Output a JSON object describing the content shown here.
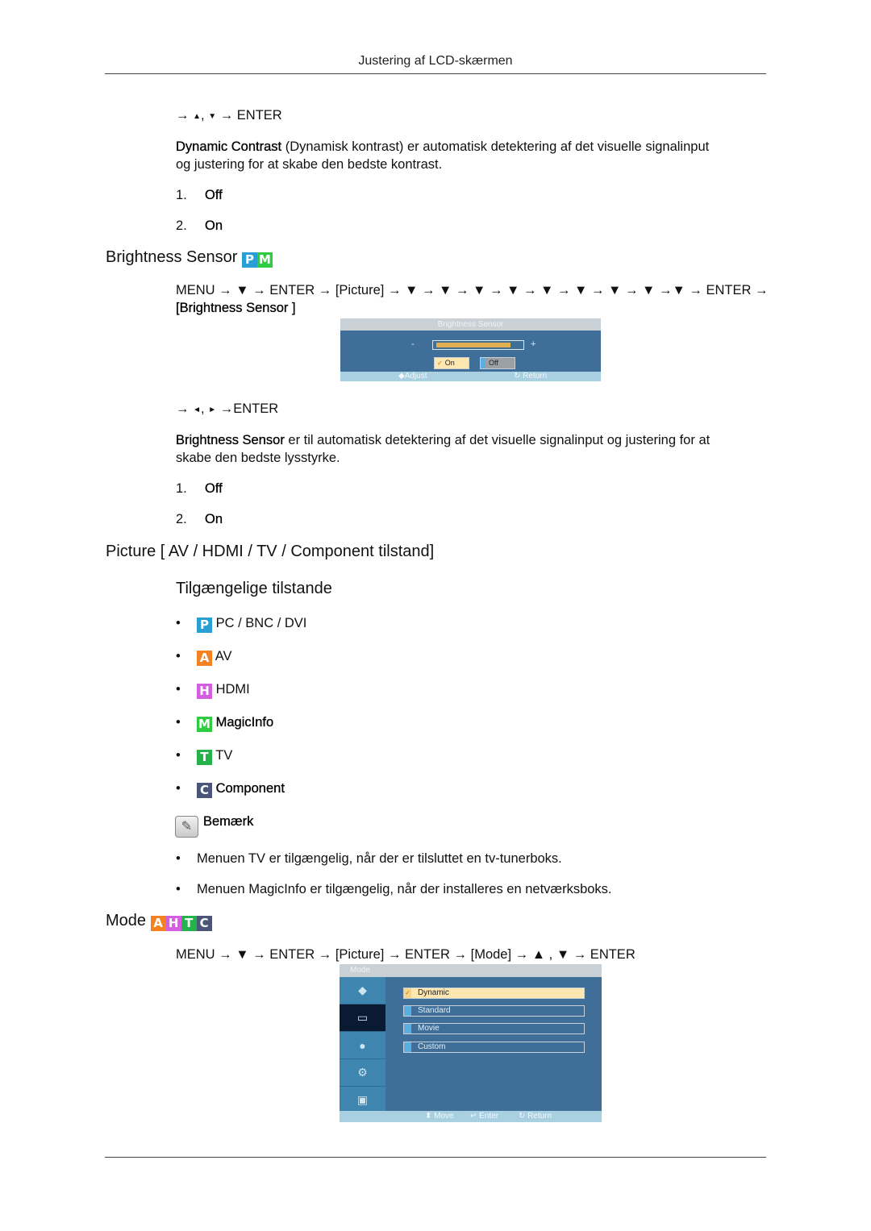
{
  "header": {
    "title": "Justering af LCD-skærmen"
  },
  "dynamic_contrast": {
    "nav": {
      "prefix": "→",
      "up": "▲",
      "sep": ",",
      "down": "▼",
      "suffix": "→ ENTER"
    },
    "term": "Dynamic Contrast",
    "description_line1": " (Dynamisk kontrast) er automatisk detektering af det visuelle signalinput",
    "description_line2": "og justering for at skabe den bedste kontrast.",
    "options": [
      {
        "num": "1.",
        "label": "Off"
      },
      {
        "num": "2.",
        "label": "On"
      }
    ]
  },
  "brightness_sensor": {
    "heading": "Brightness Sensor",
    "badges": [
      {
        "letter": "P",
        "color": "#2a9fd6"
      },
      {
        "letter": "M",
        "color": "#2ecc40"
      }
    ],
    "menu_path_line1": "MENU → ▼ → ENTER → [Picture] → ▼ → ▼ → ▼ → ▼ → ▼ → ▼ → ▼ → ▼ →▼ → ENTER →",
    "menu_path_line2": "[Brightness Sensor ]",
    "osd": {
      "title": "Brightness Sensor",
      "minus": "-",
      "plus": "+",
      "level_percent": 88,
      "on_label": "On",
      "off_label": "Off",
      "check": "✓",
      "footer_adjust": "◆Adjust",
      "footer_return": "↻ Return"
    },
    "nav": {
      "prefix": "→",
      "left": "◄",
      "sep": ",",
      "right": "►",
      "suffix": "→ENTER"
    },
    "term": "Brightness Sensor",
    "description_line1": "  er til automatisk detektering af det visuelle signalinput og justering for at",
    "description_line2": "skabe den bedste lysstyrke.",
    "options": [
      {
        "num": "1.",
        "label": "Off"
      },
      {
        "num": "2.",
        "label": "On"
      }
    ]
  },
  "picture_section": {
    "heading": "Picture [ AV / HDMI / TV / Component tilstand]",
    "subheading": "Tilgængelige tilstande",
    "modes": [
      {
        "letter": "P",
        "color": "#2a9fd6",
        "label": "PC / BNC / DVI"
      },
      {
        "letter": "A",
        "color": "#f58220",
        "label": "AV"
      },
      {
        "letter": "H",
        "color": "#d35fe0",
        "label": "HDMI"
      },
      {
        "letter": "M",
        "color": "#2ecc40",
        "label": "MagicInfo"
      },
      {
        "letter": "T",
        "color": "#23b34a",
        "label": "TV"
      },
      {
        "letter": "C",
        "color": "#4a5578",
        "label": "Component"
      }
    ],
    "note_label": "Bemærk",
    "notes": [
      "Menuen TV er tilgængelig, når der er tilsluttet en tv-tunerboks.",
      "Menuen MagicInfo er tilgængelig, når der installeres en netværksboks."
    ]
  },
  "mode_section": {
    "heading": "Mode",
    "badges": [
      {
        "letter": "A",
        "color": "#f58220"
      },
      {
        "letter": "H",
        "color": "#d35fe0"
      },
      {
        "letter": "T",
        "color": "#23b34a"
      },
      {
        "letter": "C",
        "color": "#4a5578"
      }
    ],
    "menu_path": "MENU → ▼ → ENTER → [Picture] → ENTER → [Mode] → ▲ , ▼ → ENTER",
    "osd": {
      "title": "Mode",
      "side_icons": [
        "input-icon",
        "picture-icon",
        "sound-icon",
        "setup-icon",
        "multi-control-icon"
      ],
      "options": [
        "Dynamic",
        "Standard",
        "Movie",
        "Custom"
      ],
      "selected": "Dynamic",
      "check": "✓",
      "footer_move": "⬍ Move",
      "footer_enter": "↵ Enter",
      "footer_return": "↻ Return"
    }
  }
}
